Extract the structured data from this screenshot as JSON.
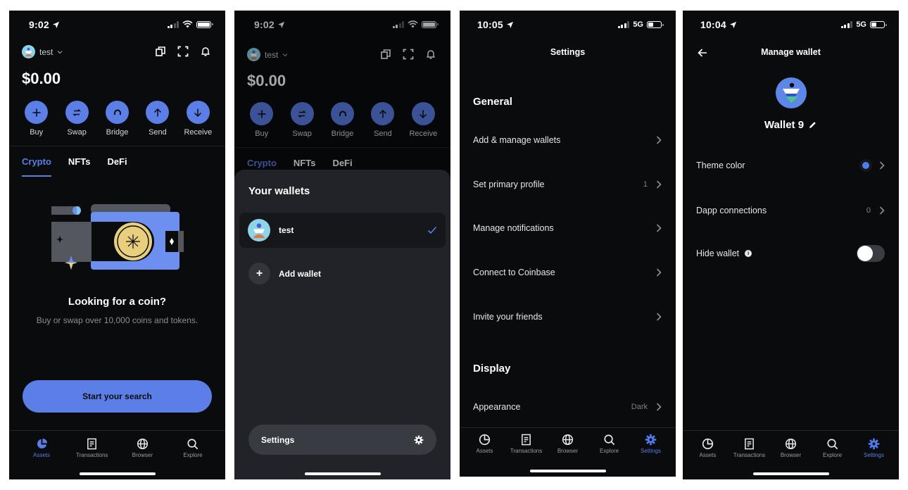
{
  "colors": {
    "accent": "#5b7fe6",
    "background": "#0a0b0d",
    "sheet": "#222328",
    "coin": "#e8cf7e"
  },
  "screens": {
    "assets": {
      "status": {
        "time": "9:02"
      },
      "account_name": "test",
      "balance": "$0.00",
      "actions": [
        {
          "label": "Buy",
          "icon": "plus-icon"
        },
        {
          "label": "Swap",
          "icon": "swap-icon"
        },
        {
          "label": "Bridge",
          "icon": "bridge-icon"
        },
        {
          "label": "Send",
          "icon": "arrow-up-icon"
        },
        {
          "label": "Receive",
          "icon": "arrow-down-icon"
        }
      ],
      "tabs": [
        {
          "label": "Crypto",
          "active": true
        },
        {
          "label": "NFTs"
        },
        {
          "label": "DeFi"
        }
      ],
      "empty_title": "Looking for a coin?",
      "empty_subtitle": "Buy or swap over 10,000 coins and tokens.",
      "cta": "Start your search",
      "tabbar": [
        {
          "label": "Assets",
          "active": true
        },
        {
          "label": "Transactions"
        },
        {
          "label": "Browser"
        },
        {
          "label": "Explore"
        }
      ]
    },
    "wallet_switcher": {
      "status": {
        "time": "9:02"
      },
      "account_name": "test",
      "balance": "$0.00",
      "actions": [
        "Buy",
        "Swap",
        "Bridge",
        "Send",
        "Receive"
      ],
      "tabs": [
        "Crypto",
        "NFTs",
        "DeFi"
      ],
      "sheet_title": "Your wallets",
      "wallets": [
        {
          "name": "test",
          "selected": true
        }
      ],
      "add_wallet": "Add wallet",
      "settings": "Settings"
    },
    "settings": {
      "status": {
        "time": "10:05",
        "network": "5G"
      },
      "title": "Settings",
      "sections": [
        {
          "title": "General",
          "rows": [
            {
              "label": "Add & manage wallets",
              "value": ""
            },
            {
              "label": "Set primary profile",
              "value": "1"
            },
            {
              "label": "Manage notifications",
              "value": ""
            },
            {
              "label": "Connect to Coinbase",
              "value": ""
            },
            {
              "label": "Invite your friends",
              "value": ""
            }
          ]
        },
        {
          "title": "Display",
          "rows": [
            {
              "label": "Appearance",
              "value": "Dark"
            }
          ]
        }
      ],
      "tabbar": [
        {
          "label": "Assets"
        },
        {
          "label": "Transactions"
        },
        {
          "label": "Browser"
        },
        {
          "label": "Explore"
        },
        {
          "label": "Settings",
          "active": true
        }
      ]
    },
    "manage_wallet": {
      "status": {
        "time": "10:04",
        "network": "5G"
      },
      "title": "Manage wallet",
      "wallet_name": "Wallet 9",
      "rows": [
        {
          "label": "Theme color",
          "value": "",
          "color": "#4f7cf0"
        },
        {
          "label": "Dapp connections",
          "value": "0"
        },
        {
          "label": "Hide wallet",
          "toggle": false
        }
      ],
      "tabbar": [
        {
          "label": "Assets"
        },
        {
          "label": "Transactions"
        },
        {
          "label": "Browser"
        },
        {
          "label": "Explore"
        },
        {
          "label": "Settings",
          "active": true
        }
      ]
    }
  }
}
